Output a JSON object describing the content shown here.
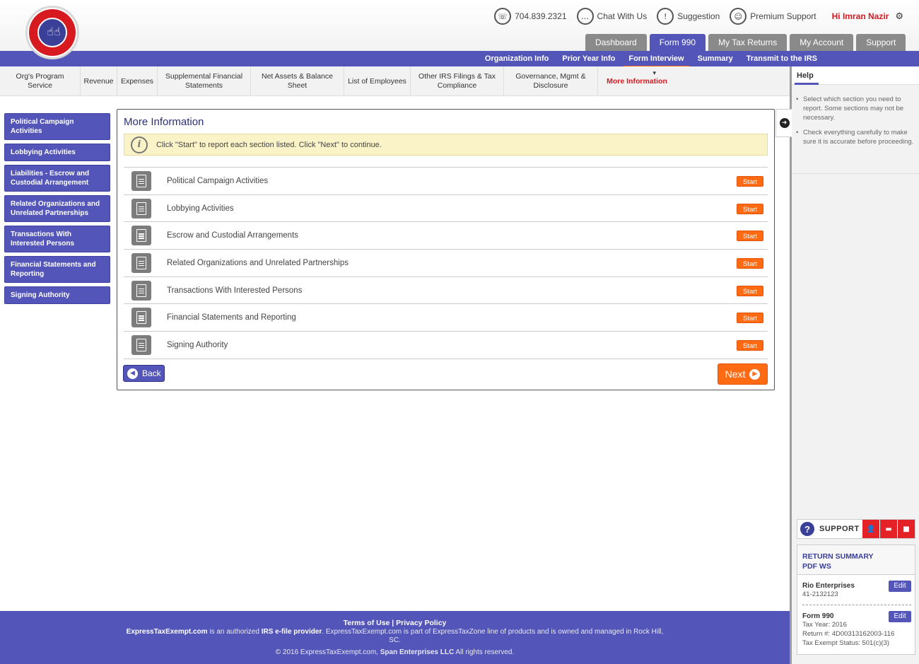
{
  "brand": {
    "logo_text": "EXPRESS TAX EXEMPT"
  },
  "topbar": {
    "phone": "704.839.2321",
    "chat": "Chat With Us",
    "suggestion": "Suggestion",
    "premium": "Premium Support",
    "greeting": "Hi Imran Nazir"
  },
  "main_tabs": [
    "Dashboard",
    "Form 990",
    "My Tax Returns",
    "My Account",
    "Support"
  ],
  "sub_tabs": [
    "Organization Info",
    "Prior Year Info",
    "Form Interview",
    "Summary",
    "Transmit to the IRS"
  ],
  "section_tabs": [
    "Org's Program Service",
    "Revenue",
    "Expenses",
    "Supplemental Financial Statements",
    "Net Assets & Balance Sheet",
    "List of Employees",
    "Other IRS Filings & Tax Compliance",
    "Governance, Mgmt & Disclosure",
    "More Information"
  ],
  "sidebar": [
    "Political Campaign Activities",
    "Lobbying Activities",
    "Liabilities - Escrow and Custodial Arrangement",
    "Related Organizations and Unrelated Partnerships",
    "Transactions With Interested Persons",
    "Financial Statements and Reporting",
    "Signing Authority"
  ],
  "content": {
    "title": "More Information",
    "info": "Click \"Start\" to report each section listed. Click \"Next\" to continue.",
    "sections": [
      "Political Campaign Activities",
      "Lobbying Activities",
      "Escrow and Custodial Arrangements",
      "Related Organizations and Unrelated Partnerships",
      "Transactions With Interested Persons",
      "Financial Statements and Reporting",
      "Signing Authority"
    ],
    "start_label": "Start",
    "back_label": "Back",
    "next_label": "Next"
  },
  "help": {
    "title": "Help",
    "items": [
      "Select which section you need to report. Some sections may not be necessary.",
      "Check everything carefully to make sure it is accurate before proceeding."
    ]
  },
  "support": {
    "label": "SUPPORT"
  },
  "summary": {
    "title": "RETURN SUMMARY",
    "subtitle": "PDF  WS",
    "org_name": "Rio Enterprises",
    "ein": "41-2132123",
    "form": "Form 990",
    "tax_year": "Tax Year: 2016",
    "return_no": "Return #: 4D00313162003-116",
    "status": "Tax Exempt Status: 501(c)(3)",
    "edit_label": "Edit"
  },
  "footer": {
    "terms": "Terms of Use",
    "sep": " | ",
    "privacy": "Privacy Policy",
    "site": "ExpressTaxExempt.com",
    "desc1": " is an authorized ",
    "irs": "IRS e-file provider",
    "desc2": ". ExpressTaxExempt.com is part of ExpressTaxZone line of products and is owned and managed in Rock Hill, SC.",
    "copy1": "© 2016 ExpressTaxExempt.com, ",
    "company": "Span Enterprises LLC",
    "copy2": " All rights reserved."
  }
}
